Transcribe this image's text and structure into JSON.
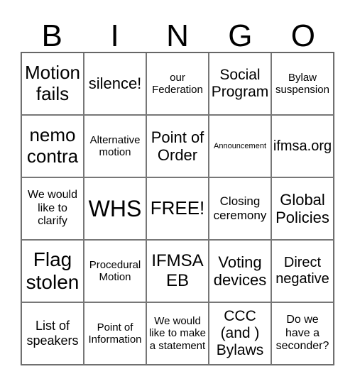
{
  "header": [
    "B",
    "I",
    "N",
    "G",
    "O"
  ],
  "cells": [
    [
      "Motion fails",
      "silence!",
      "our Federation",
      "Social Program",
      "Bylaw suspension"
    ],
    [
      "nemo contra",
      "Alternative motion",
      "Point of Order",
      "Announcement",
      "ifmsa.org"
    ],
    [
      "We would like to clarify",
      "WHS",
      "FREE!",
      "Closing ceremony",
      "Global Policies"
    ],
    [
      "Flag stolen",
      "Procedural Motion",
      "IFMSA EB",
      "Voting devices",
      "Direct negative"
    ],
    [
      "List of speakers",
      "Point of Information",
      "We would like to make a statement",
      "CCC (and ) Bylaws",
      "Do we have a seconder?"
    ]
  ]
}
